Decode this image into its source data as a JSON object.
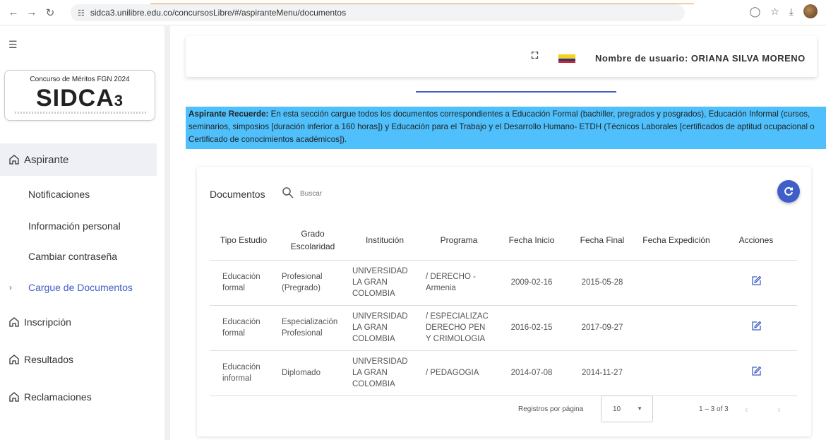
{
  "browser": {
    "url": "sidca3.unilibre.edu.co/concursosLibre/#/aspiranteMenu/documentos"
  },
  "sidebar": {
    "logo_top": "Concurso de Méritos FGN 2024",
    "logo_main": "SIDCA",
    "logo_suffix": "3",
    "aspirante": "Aspirante",
    "sub_items": [
      "Notificaciones",
      "Información personal",
      "Cambiar contraseña",
      "Cargue de Documentos"
    ],
    "items": [
      "Inscripción",
      "Resultados",
      "Reclamaciones"
    ]
  },
  "header": {
    "user_label": "Nombre de usuario: ORIANA SILVA MORENO"
  },
  "notice": {
    "bold": "Aspirante Recuerde:",
    "text": " En esta sección cargue todos los documentos correspondientes a Educación Formal (bachiller, pregrados y posgrados), Educación Informal (cursos, seminarios, simposios [duración inferior a 160 horas]) y Educación para el Trabajo y el Desarrollo Humano- ETDH (Técnicos Laborales [certificados de aptitud ocupacional o Certificado de conocimientos académicos])."
  },
  "documents": {
    "title": "Documentos",
    "search_placeholder": "Buscar",
    "headers": [
      "Tipo Estudio",
      "Grado Escolaridad",
      "Institución",
      "Programa",
      "Fecha Inicio",
      "Fecha Final",
      "Fecha Expedición",
      "Acciones"
    ],
    "rows": [
      {
        "tipo": "Educación formal",
        "grado": "Profesional (Pregrado)",
        "inst": "UNIVERSIDAD LA GRAN COLOMBIA",
        "prog": "/ DERECHO - Armenia",
        "inicio": "2009-02-16",
        "final": "2015-05-28",
        "exped": ""
      },
      {
        "tipo": "Educación formal",
        "grado": "Especialización Profesional",
        "inst": "UNIVERSIDAD LA GRAN COLOMBIA",
        "prog": "/ ESPECIALIZAC DERECHO PEN Y CRIMOLOGIA",
        "inicio": "2016-02-15",
        "final": "2017-09-27",
        "exped": ""
      },
      {
        "tipo": "Educación informal",
        "grado": "Diplomado",
        "inst": "UNIVERSIDAD LA GRAN COLOMBIA",
        "prog": "/ PEDAGOGIA",
        "inicio": "2014-07-08",
        "final": "2014-11-27",
        "exped": ""
      }
    ]
  },
  "pager": {
    "label": "Registros por página",
    "per_page": "10",
    "range": "1 – 3 of 3"
  },
  "colors": {
    "accent": "#3f5ec7",
    "notice_bg": "#4fc0fb"
  }
}
